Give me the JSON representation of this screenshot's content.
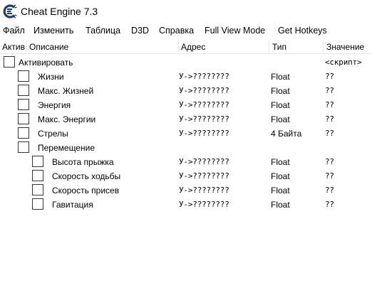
{
  "window": {
    "title": "Cheat Engine 7.3",
    "icon": "cheat-engine-logo-icon"
  },
  "menu": [
    "Файл",
    "Изменить",
    "Таблица",
    "D3D",
    "Справка",
    "Full View Mode",
    "Get Hotkeys"
  ],
  "table": {
    "headers": {
      "active": "Актив",
      "description": "Описание",
      "address": "Адрес",
      "type": "Тип",
      "value": "Значение"
    },
    "rows": [
      {
        "description": "Активировать",
        "address": "",
        "type": "",
        "value": "<скрипт>",
        "indent": 0
      },
      {
        "description": "Жизни",
        "address": "У->????????",
        "type": "Float",
        "value": "??",
        "indent": 1
      },
      {
        "description": "Макс. Жизней",
        "address": "У->????????",
        "type": "Float",
        "value": "??",
        "indent": 1
      },
      {
        "description": "Энергия",
        "address": "У->????????",
        "type": "Float",
        "value": "??",
        "indent": 1
      },
      {
        "description": "Макс. Энергии",
        "address": "У->????????",
        "type": "Float",
        "value": "??",
        "indent": 1
      },
      {
        "description": "Стрелы",
        "address": "У->????????",
        "type": "4 Байта",
        "value": "??",
        "indent": 1
      },
      {
        "description": "Перемещение",
        "address": "",
        "type": "",
        "value": "",
        "indent": 1
      },
      {
        "description": "Высота прыжка",
        "address": "У->????????",
        "type": "Float",
        "value": "??",
        "indent": 2
      },
      {
        "description": "Скорость ходьбы",
        "address": "У->????????",
        "type": "Float",
        "value": "??",
        "indent": 2
      },
      {
        "description": "Скорость присев",
        "address": "У->????????",
        "type": "Float",
        "value": "??",
        "indent": 2
      },
      {
        "description": "Гавитация",
        "address": "У->????????",
        "type": "Float",
        "value": "??",
        "indent": 2
      }
    ]
  }
}
